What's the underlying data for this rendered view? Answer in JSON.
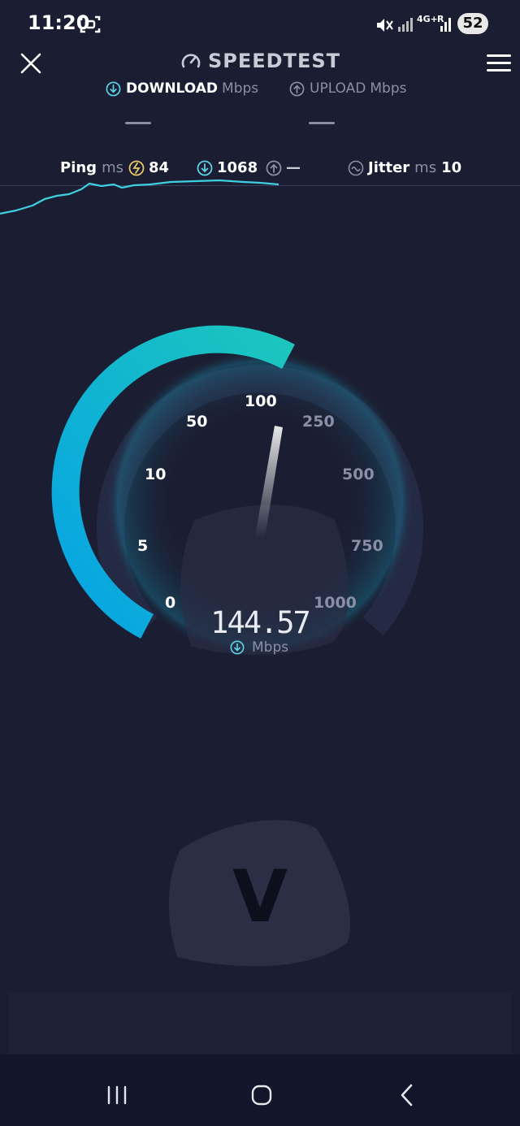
{
  "status_bar": {
    "time": "11:20",
    "network": "4G+",
    "roaming": "R",
    "battery": "52"
  },
  "header": {
    "title": "SPEEDTEST"
  },
  "tabs": {
    "download": {
      "label": "DOWNLOAD",
      "unit": "Mbps",
      "value": "—"
    },
    "upload": {
      "label": "UPLOAD",
      "unit": "Mbps",
      "value": "—"
    }
  },
  "stats": {
    "ping_label": "Ping",
    "ping_unit": "ms",
    "ping_value": "84",
    "download_ping": "1068",
    "upload_ping": "—",
    "jitter_label": "Jitter",
    "jitter_unit": "ms",
    "jitter_value": "10"
  },
  "gauge": {
    "ticks": [
      "0",
      "5",
      "10",
      "50",
      "100",
      "250",
      "500",
      "750",
      "1000"
    ],
    "reading": "144.57",
    "unit": "Mbps"
  },
  "watermark": "V",
  "icons": {
    "close": "close-icon",
    "speedometer": "speedometer-icon",
    "menu": "menu-icon",
    "download": "download-arrow-icon",
    "upload": "upload-arrow-icon",
    "jitter": "jitter-icon",
    "ping": "ping-icon"
  },
  "colors": {
    "background": "#1b1e32",
    "accent_cyan": "#20c3c0",
    "accent_blue": "#0aa8e0",
    "track": "#262b44"
  }
}
